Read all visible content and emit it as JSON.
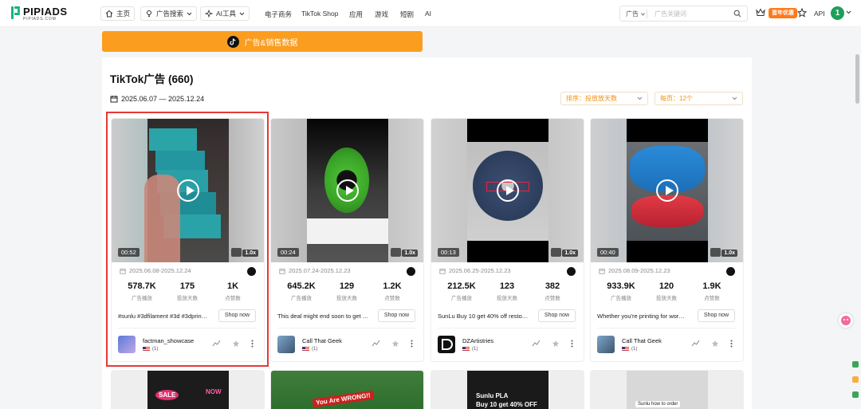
{
  "nav": {
    "logo_text": "PIPIADS",
    "logo_sub": "PIPIADS.COM",
    "home": "主页",
    "ad_search": "广告搜索",
    "ai_tools": "AI工具",
    "links": [
      "电子商务",
      "TikTok Shop",
      "应用",
      "游戏",
      "短剧",
      "AI"
    ],
    "search_select": "广告",
    "search_placeholder": "广告关键词",
    "promo": "首年优惠",
    "api": "API",
    "avatar_initial": "1"
  },
  "banner": {
    "label": "广告&销售数据"
  },
  "panel": {
    "title": "TikTok广告 (660)",
    "date_range": "2025.06.07 — 2025.12.24",
    "sort_label": "排序：投放放天数",
    "per_page_label": "每页：12个"
  },
  "stat_labels": {
    "plays": "广告播放",
    "days": "投放天数",
    "likes": "点赞数"
  },
  "cards": [
    {
      "duration": "00:52",
      "speed": "1.0x",
      "date_range": "2025.06.08-2025.12.24",
      "plays": "578.7K",
      "days": "175",
      "likes": "1K",
      "desc": "#sunlu #3dfilament #3d #3dprin…",
      "shop": "Shop now",
      "advertiser": "factman_showcase",
      "country_count": "(1)"
    },
    {
      "duration": "00:24",
      "speed": "1.0x",
      "date_range": "2025.07.24-2025.12.23",
      "plays": "645.2K",
      "days": "129",
      "likes": "1.2K",
      "desc": "This deal might end soon to get …",
      "shop": "Shop now",
      "advertiser": "Call That Geek",
      "country_count": "(1)"
    },
    {
      "duration": "00:13",
      "speed": "1.0x",
      "date_range": "2025.06.25-2025.12.23",
      "plays": "212.5K",
      "days": "123",
      "likes": "382",
      "desc": "SunLu Buy 10 get 40% off resto…",
      "shop": "Shop now",
      "advertiser": "DZArtistries",
      "country_count": "(1)"
    },
    {
      "duration": "00:40",
      "speed": "1.0x",
      "date_range": "2025.08.09-2025.12.23",
      "plays": "933.9K",
      "days": "120",
      "likes": "1.9K",
      "desc": "Whether you're printing for wor…",
      "shop": "Shop now",
      "advertiser": "Call That Geek",
      "country_count": "(1)"
    }
  ],
  "row2": {
    "card1_text": "SALE",
    "card1_text2": "NOW",
    "card2_text": "You Are WRONG!!",
    "card3_line1": "Sunlu PLA",
    "card3_line2": "Buy 10 get 40% OFF",
    "card4_text": "Sunlu how to order"
  },
  "colors": {
    "accent": "#fb9d1f",
    "brand": "#17b37f",
    "selection": "#e53935",
    "promo": "#ff7a1a"
  }
}
